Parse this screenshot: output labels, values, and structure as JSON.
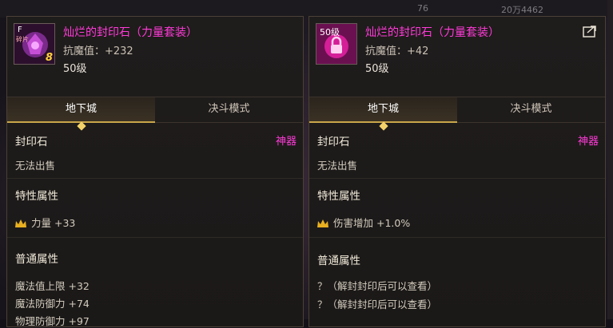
{
  "topbar": {
    "a": "76",
    "b": "20万4462"
  },
  "left": {
    "icon_level": "F",
    "icon_corner": "碎片",
    "icon_number": "8",
    "name": "灿烂的封印石（力量套装）",
    "stat": "抗魔值：+232",
    "level": "50级",
    "tab_active": "地下城",
    "tab_inactive": "决斗模式",
    "type_label": "封印石",
    "type_rarity": "神器",
    "sell": "无法出售",
    "special_header": "特性属性",
    "special_line": "力量 +33",
    "normal_header": "普通属性",
    "normal_lines": [
      "魔法值上限 +32",
      "魔法防御力 +74",
      "物理防御力 +97"
    ]
  },
  "right": {
    "icon_level": "50级",
    "name": "灿烂的封印石（力量套装）",
    "stat": "抗魔值：+42",
    "level": "50级",
    "tab_active": "地下城",
    "tab_inactive": "决斗模式",
    "type_label": "封印石",
    "type_rarity": "神器",
    "sell": "无法出售",
    "special_header": "特性属性",
    "special_line": "伤害增加 +1.0%",
    "normal_header": "普通属性",
    "normal_lines": [
      "？（解封封印后可以查看）",
      "？（解封封印后可以查看）"
    ]
  },
  "colors": {
    "accent_pink": "#ff3bd8",
    "gold": "#c9a64a"
  }
}
